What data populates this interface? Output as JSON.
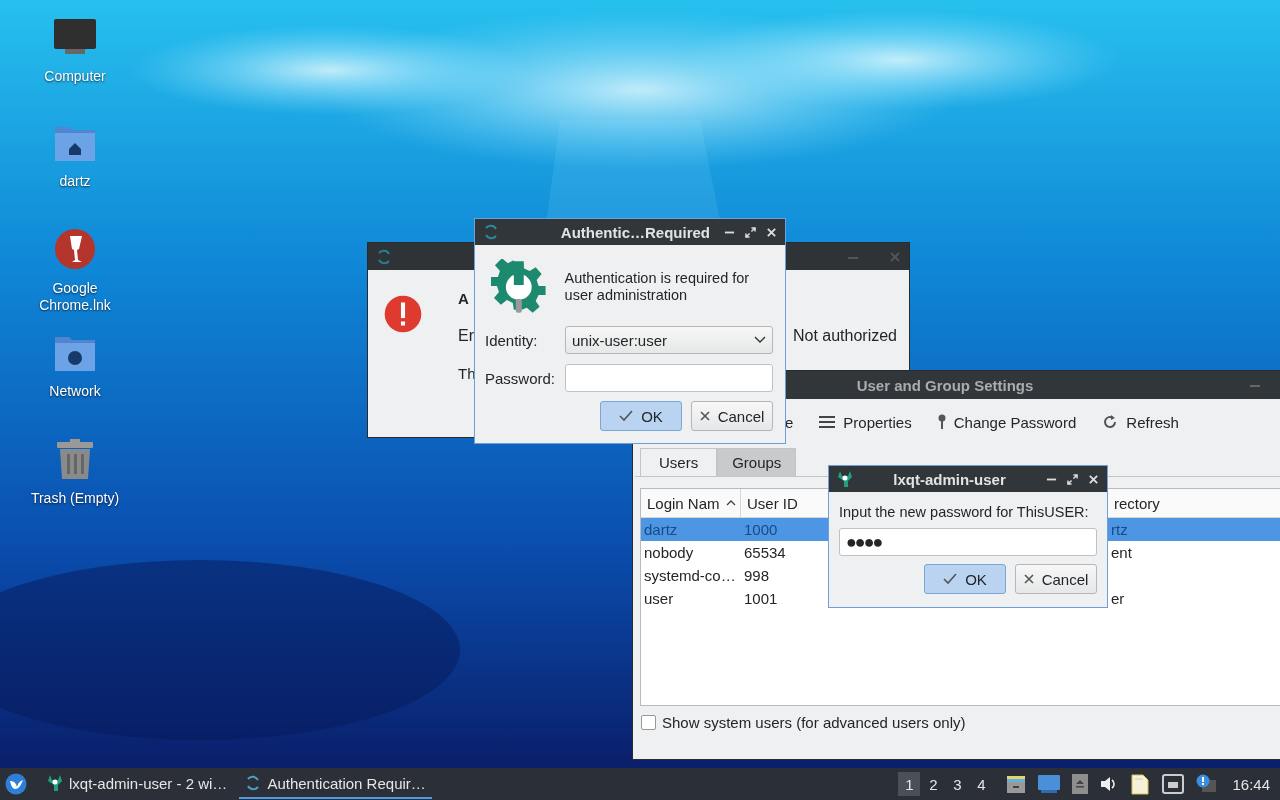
{
  "desktop_icons": [
    {
      "label": "Computer",
      "kind": "computer"
    },
    {
      "label": "dartz",
      "kind": "home"
    },
    {
      "label": "Google Chrome.lnk",
      "kind": "wine"
    },
    {
      "label": "Network",
      "kind": "network"
    },
    {
      "label": "Trash (Empty)",
      "kind": "trash"
    }
  ],
  "error_dialog": {
    "heading": "A",
    "line_1_start": "Er",
    "line_1_end": "Not authorized",
    "line_2_start": "Th"
  },
  "settings_window": {
    "title": "User and Group Settings",
    "toolbar": [
      {
        "label": "e",
        "kind": "plain"
      },
      {
        "label": "Properties",
        "kind": "properties"
      },
      {
        "label": "Change Password",
        "kind": "password"
      },
      {
        "label": "Refresh",
        "kind": "refresh"
      }
    ],
    "tabs": [
      {
        "label": "Users",
        "selected": true
      },
      {
        "label": "Groups",
        "selected": false
      }
    ],
    "table": {
      "columns": [
        {
          "label": "Login Nam",
          "sorted": true
        },
        {
          "label": "User ID",
          "sorted": false
        },
        {
          "label": "rectory",
          "sorted": false
        }
      ],
      "rows": [
        {
          "cells": [
            "dartz",
            "1000",
            "rtz"
          ],
          "selected": true
        },
        {
          "cells": [
            "nobody",
            "65534",
            "ent"
          ],
          "selected": false
        },
        {
          "cells": [
            "systemd-co…",
            "998"
          ],
          "selected": false
        },
        {
          "cells": [
            "user",
            "1001",
            "er"
          ],
          "selected": false
        }
      ]
    },
    "show_system_users": {
      "label": "Show system users (for advanced users only)",
      "checked": false
    }
  },
  "auth_dialog": {
    "title": "Authentic…Required",
    "message": "Authentication is required for user administration",
    "identity_label": "Identity:",
    "identity_value": "unix-user:user",
    "password_label": "Password:",
    "buttons": [
      {
        "label": "OK",
        "kind": "ok",
        "default": true
      },
      {
        "label": "Cancel",
        "kind": "cancel",
        "default": false
      }
    ]
  },
  "password_dialog": {
    "title": "lxqt-admin-user",
    "prompt": "Input the new password for ThisUSER:",
    "value": "●●●●",
    "buttons": [
      {
        "label": "OK",
        "kind": "ok",
        "default": true
      },
      {
        "label": "Cancel",
        "kind": "cancel",
        "default": false
      }
    ]
  },
  "taskbar": {
    "tasks": [
      {
        "label": "lxqt-admin-user - 2 wi…",
        "kind": "admin",
        "selected": false
      },
      {
        "label": "Authentication Requir…",
        "kind": "auth",
        "selected": true
      }
    ],
    "desktops": [
      {
        "label": "1",
        "selected": true
      },
      {
        "label": "2",
        "selected": false
      },
      {
        "label": "3",
        "selected": false
      },
      {
        "label": "4",
        "selected": false
      }
    ],
    "clock": "16:44"
  }
}
